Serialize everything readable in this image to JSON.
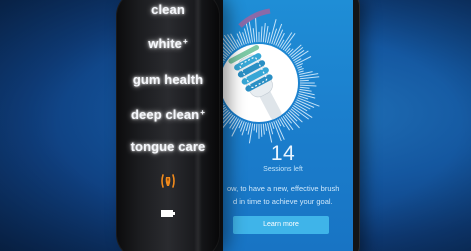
{
  "handle": {
    "modes": {
      "clean": "clean",
      "white": "white",
      "white_sup": "+",
      "gum_health": "gum health",
      "deep_clean": "deep clean",
      "deep_clean_sup": "+",
      "tongue_care": "tongue care"
    },
    "icons": {
      "pressure": "pressure-sensor-icon",
      "battery": "battery-icon"
    },
    "colors": {
      "mode_text": "#f5f7fb",
      "pressure_icon": "#f08a1c",
      "battery": "#ffffff"
    }
  },
  "app": {
    "sessions_count": "14",
    "sessions_label": "Sessions left",
    "info_line_1": "ow, to have a new, effective brush",
    "info_line_2": "d in time to achieve your goal.",
    "learn_more_label": "Learn more",
    "colors": {
      "background": "#1b7fcd",
      "button": "#3fb4e9",
      "progress_arc": "#8a6aa8"
    }
  }
}
